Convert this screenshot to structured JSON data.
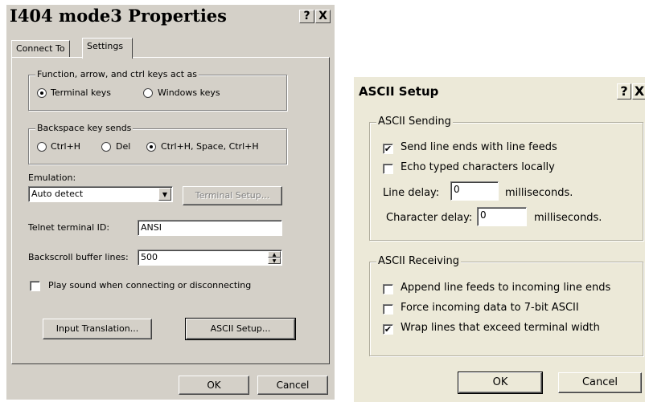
{
  "left_dialog": {
    "title": "I404 mode3 Properties",
    "help_btn": "?",
    "close_btn": "X",
    "tabs": [
      "Connect To",
      "Settings"
    ],
    "keys_group": {
      "label": "Function, arrow, and ctrl keys act as",
      "options": [
        "Terminal keys",
        "Windows keys"
      ],
      "selected": "Terminal keys"
    },
    "backspace_group": {
      "label": "Backspace key sends",
      "options": [
        "Ctrl+H",
        "Del",
        "Ctrl+H, Space, Ctrl+H"
      ],
      "selected": "Ctrl+H, Space, Ctrl+H"
    },
    "emulation_label": "Emulation:",
    "emulation_value": "Auto detect",
    "terminal_setup_btn": "Terminal Setup...",
    "telnet_id_label": "Telnet terminal ID:",
    "telnet_id_value": "ANSI",
    "backscroll_label": "Backscroll buffer lines:",
    "backscroll_value": "500",
    "play_sound_label": "Play sound when connecting or disconnecting",
    "input_translation_btn": "Input Translation...",
    "ascii_setup_btn": "ASCII Setup...",
    "ok_btn": "OK",
    "cancel_btn": "Cancel"
  },
  "right_dialog": {
    "title": "ASCII Setup",
    "help_btn": "?",
    "close_btn": "X",
    "sending_group": {
      "label": "ASCII Sending",
      "send_line_ends": "Send line ends with line feeds",
      "echo_typed": "Echo typed characters locally",
      "line_delay_label": "Line delay:",
      "line_delay_value": "0",
      "line_delay_unit": "milliseconds.",
      "char_delay_label": "Character delay:",
      "char_delay_value": "0",
      "char_delay_unit": "milliseconds."
    },
    "receiving_group": {
      "label": "ASCII Receiving",
      "append_lf": "Append line feeds to incoming line ends",
      "force_7bit": "Force incoming data to 7-bit ASCII",
      "wrap_lines": "Wrap lines that exceed terminal width"
    },
    "ok_btn": "OK",
    "cancel_btn": "Cancel"
  }
}
